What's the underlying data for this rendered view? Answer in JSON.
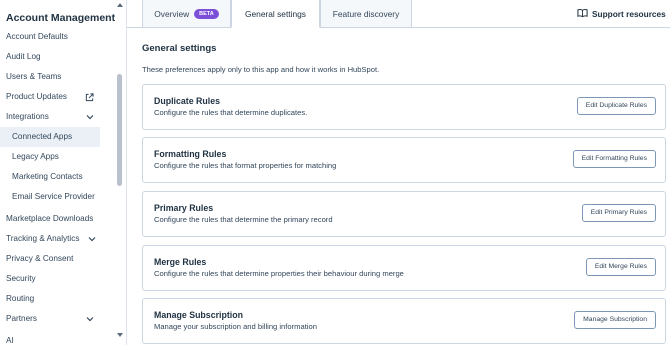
{
  "sidebar": {
    "title": "Account Management",
    "items": [
      {
        "label": "Account Defaults"
      },
      {
        "label": "Audit Log"
      },
      {
        "label": "Users & Teams"
      },
      {
        "label": "Product Updates",
        "icon": "external-link-icon"
      },
      {
        "label": "Integrations",
        "icon": "chevron-up-icon"
      },
      {
        "label": "Connected Apps",
        "active": true
      },
      {
        "label": "Legacy Apps"
      },
      {
        "label": "Marketing Contacts"
      },
      {
        "label": "Email Service Provider"
      },
      {
        "label": "Marketplace Downloads"
      },
      {
        "label": "Tracking & Analytics",
        "icon": "chevron-down-icon"
      },
      {
        "label": "Privacy & Consent"
      },
      {
        "label": "Security"
      },
      {
        "label": "Routing"
      },
      {
        "label": "Partners",
        "icon": "chevron-down-icon"
      },
      {
        "label": "AI"
      }
    ]
  },
  "tabs": [
    {
      "label": "Overview",
      "badge": "BETA"
    },
    {
      "label": "General settings",
      "active": true
    },
    {
      "label": "Feature discovery"
    }
  ],
  "support_label": "Support resources",
  "main": {
    "title": "General settings",
    "description": "These preferences apply only to this app and how it works in HubSpot.",
    "cards": [
      {
        "title": "Duplicate Rules",
        "description": "Configure the rules that determine duplicates.",
        "button": "Edit Duplicate Rules"
      },
      {
        "title": "Formatting Rules",
        "description": "Configure the rules that format properties for matching",
        "button": "Edit Formatting Rules"
      },
      {
        "title": "Primary Rules",
        "description": "Configure the rules that determine the primary record",
        "button": "Edit Primary Rules"
      },
      {
        "title": "Merge Rules",
        "description": "Configure the rules that determine properties their behaviour during merge",
        "button": "Edit Merge Rules"
      },
      {
        "title": "Manage Subscription",
        "description": "Manage your subscription and billing information",
        "button": "Manage Subscription"
      }
    ]
  },
  "colors": {
    "accent": "#7c4fd8",
    "border": "#cbd6e2",
    "text": "#33475b",
    "heading": "#213343"
  }
}
